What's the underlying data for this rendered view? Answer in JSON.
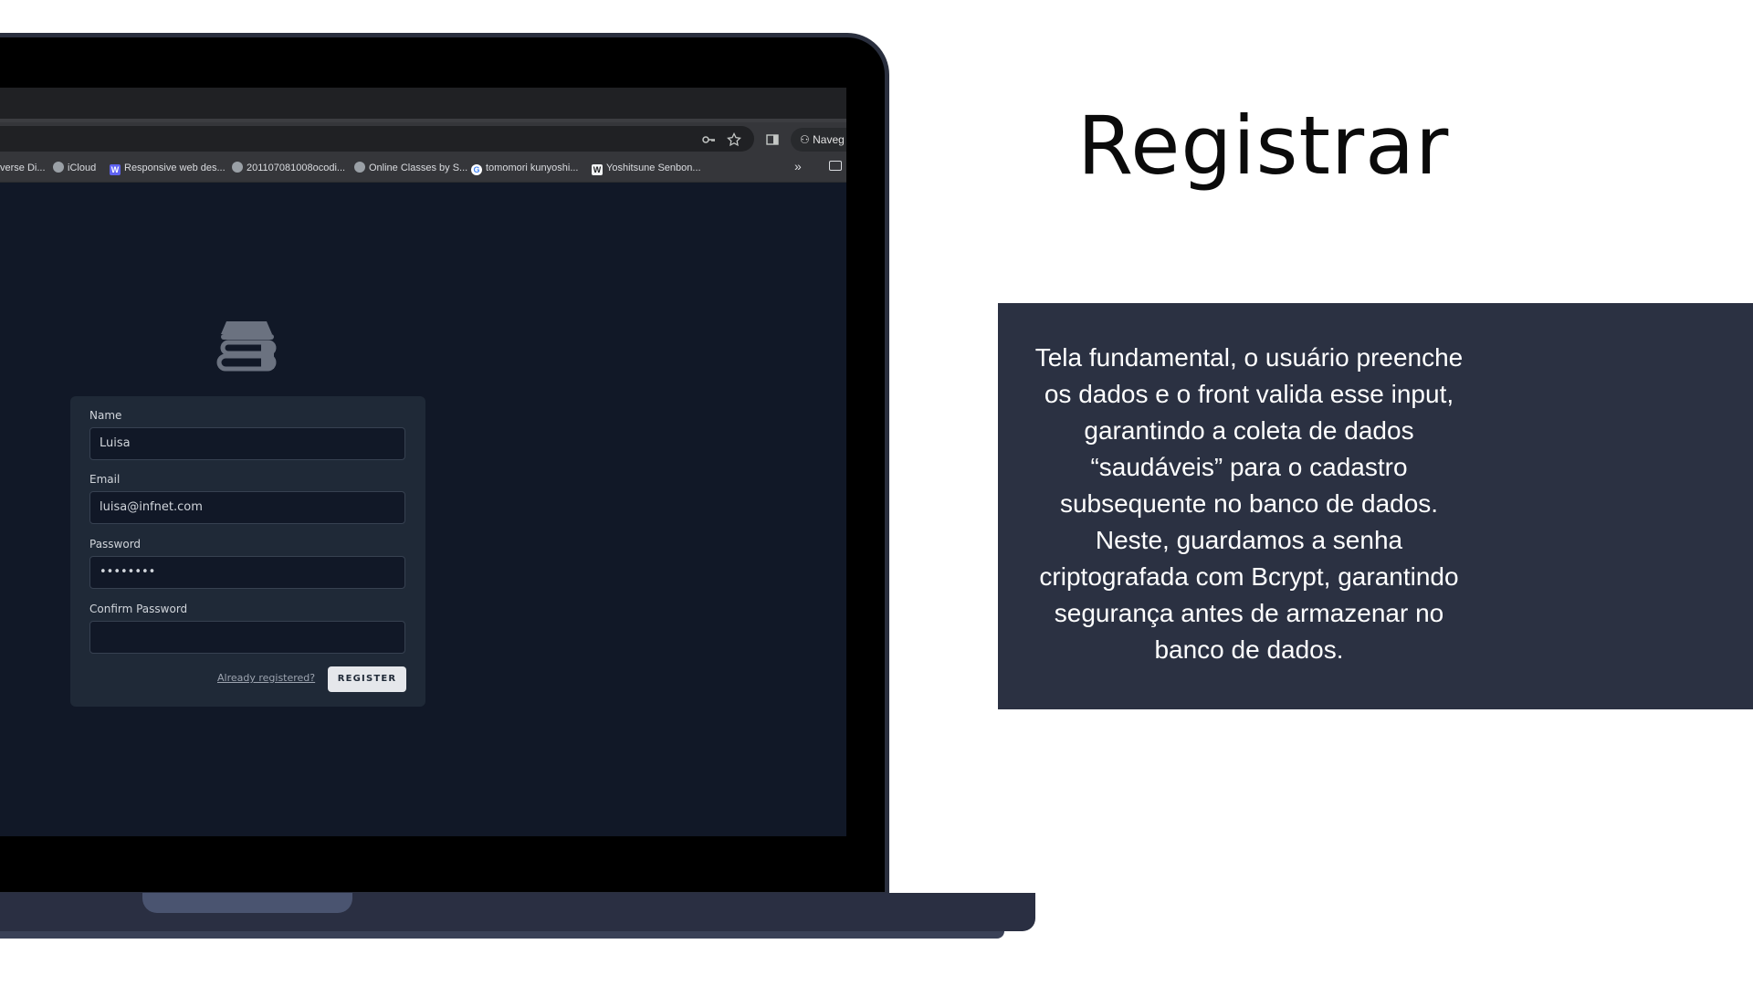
{
  "browser": {
    "profile_label": "Naveg",
    "bookmarks": [
      {
        "label": "verse Di..."
      },
      {
        "label": "iCloud"
      },
      {
        "label": "Responsive web des..."
      },
      {
        "label": "201107081008ocodi..."
      },
      {
        "label": "Online Classes by S..."
      },
      {
        "label": "tomomori kunyoshi..."
      },
      {
        "label": "Yoshitsune Senbon..."
      }
    ],
    "overflow_glyph": "»"
  },
  "form": {
    "name_label": "Name",
    "name_value": "Luisa",
    "email_label": "Email",
    "email_value": "luisa@infnet.com",
    "password_label": "Password",
    "password_value": "••••••••",
    "confirm_label": "Confirm Password",
    "confirm_value": "",
    "already_link": "Already registered?",
    "register_button": "REGISTER"
  },
  "slide": {
    "title": "Registrar",
    "description": "Tela fundamental, o usuário preenche os dados e o front valida esse input, garantindo a coleta de dados “saudáveis” para o cadastro subsequente no banco de dados. Neste, guardamos a senha criptografada com Bcrypt, garantindo segurança antes de armazenar no banco de dados."
  },
  "colors": {
    "page_bg": "#111827",
    "card_bg": "#1f2937",
    "desc_box": "#2b3142"
  },
  "icons": [
    "password-key-icon",
    "star-icon",
    "side-panel-icon",
    "incognito-icon",
    "books-logo-icon",
    "folder-icon"
  ]
}
